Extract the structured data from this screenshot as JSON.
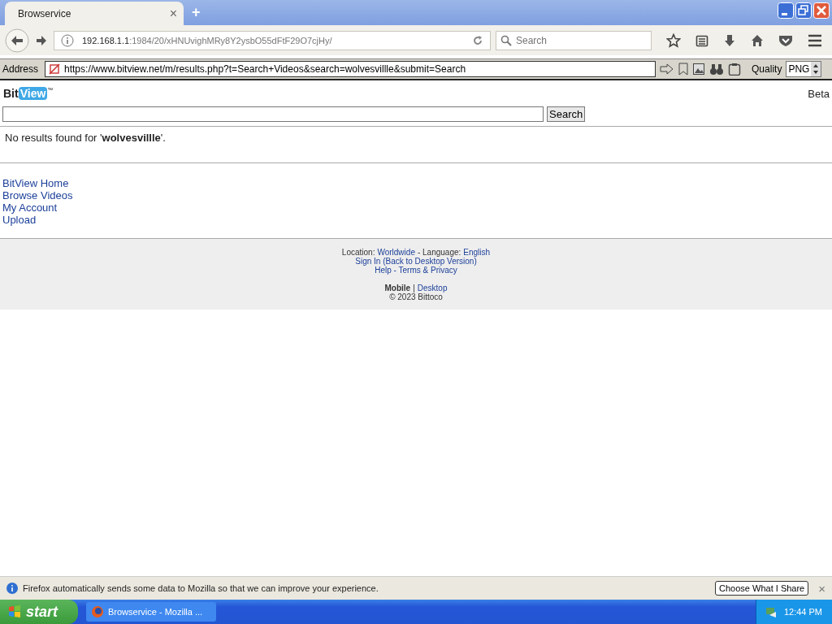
{
  "window": {
    "tabs": [
      {
        "title": "Browservice",
        "close": "×",
        "selected": true
      }
    ],
    "new_tab": "+"
  },
  "navbar": {
    "url_host": "192.168.1.1",
    "url_path": ":1984/20/xHNUvighMRy8Y2ysbO55dFtF29O7cjHy/",
    "search": {
      "placeholder": "Search"
    }
  },
  "address_bar": {
    "label": "Address",
    "url": "https://www.bitview.net/m/results.php?t=Search+Videos&search=wolvesvillle&submit=Search",
    "quality_label": "Quality",
    "quality_value": "PNG"
  },
  "page": {
    "logo": {
      "part_1": "Bit",
      "part_2": "View",
      "mark": "™"
    },
    "beta": "Beta",
    "search": {
      "button": "Search"
    },
    "message": "No results found for '**wolvesvillle**'.",
    "links": [
      "BitView Home",
      "Browse Videos",
      "My Account",
      "Upload"
    ],
    "footer": {
      "lines": [
        [
          {
            "kind": "text",
            "text": "Location:"
          },
          {
            "kind": "link",
            "text": "Worldwide"
          },
          {
            "kind": "text",
            "text": "- Language:"
          },
          {
            "kind": "link",
            "text": "English"
          }
        ],
        [
          {
            "kind": "link",
            "text": "Sign In (Back to Desktop Version)"
          }
        ],
        [
          {
            "kind": "link",
            "text": "Help - Terms & Privacy"
          }
        ],
        [
          {
            "kind": "bold",
            "text": "Mobile"
          },
          {
            "kind": "text",
            "text": "|"
          },
          {
            "kind": "link",
            "text": "Desktop"
          }
        ],
        [
          {
            "kind": "text",
            "text": "© 2023 Bittoco"
          }
        ]
      ]
    }
  },
  "notification": {
    "text": "Firefox automatically sends some data to Mozilla so that we can improve your experience.",
    "button": "Choose What I Share",
    "close": "×"
  },
  "taskbar": {
    "start": "start",
    "task": "Browservice - Mozilla ...",
    "clock": "12:44 PM"
  }
}
